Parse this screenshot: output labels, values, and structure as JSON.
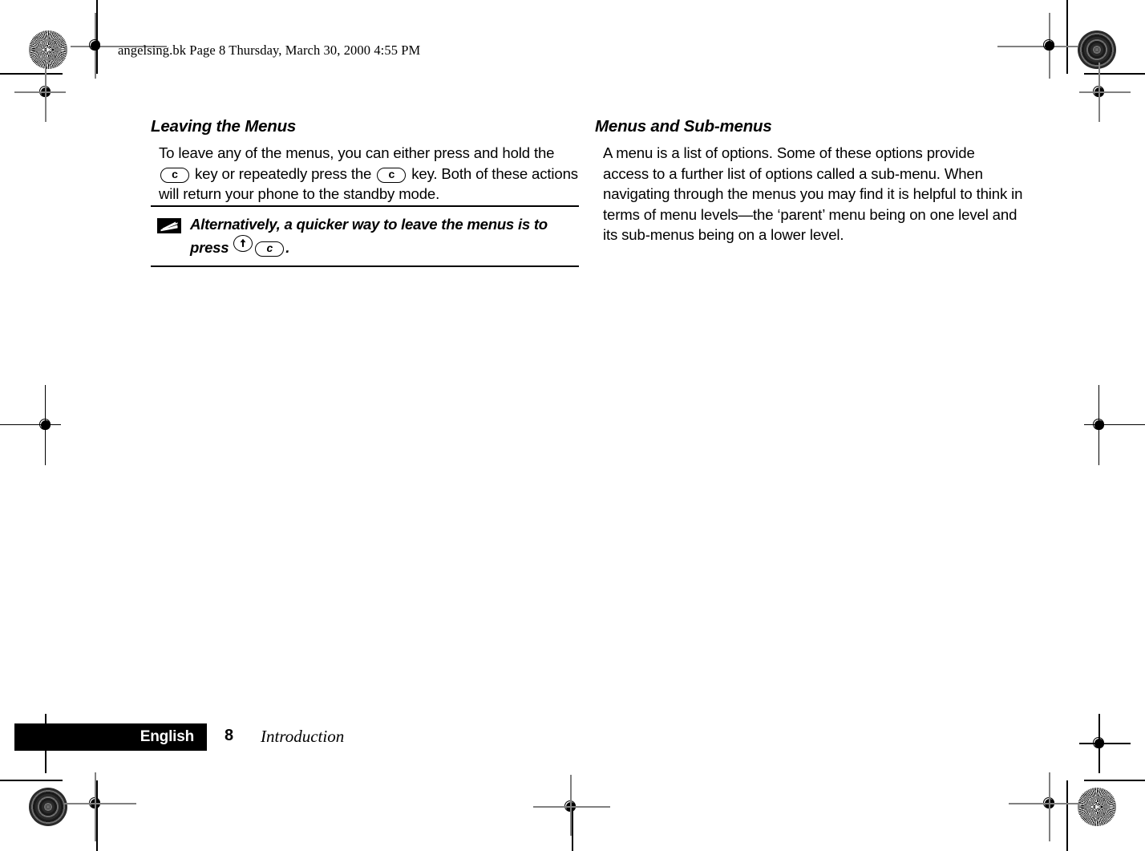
{
  "page": {
    "slug": "angelsing.bk  Page 8  Thursday, March 30, 2000  4:55 PM",
    "background": "#ffffff",
    "ink": "#000000"
  },
  "columns": {
    "left": {
      "heading": "Leaving the Menus",
      "paragraph_part1": "To leave any of the menus, you can either press and hold the ",
      "key1_label": "c",
      "paragraph_part2": " key or repeatedly press the ",
      "key2_label": "c",
      "paragraph_part3": " key. Both of these actions will return your phone to the standby mode."
    },
    "right": {
      "heading": "Menus and Sub-menus",
      "paragraph": "A menu is a list of options. Some of these options provide access to a further list of options called a sub-menu. When navigating through the menus you may find it is helpful to think in terms of menu levels—the ‘parent’ menu being on one level and its sub-menus being on a lower level."
    }
  },
  "note": {
    "icon_name": "lightning-bolt-icon",
    "text_part1": "Alternatively, a quicker way to leave the menus is to press ",
    "key_up_label": "",
    "key_c_label": "c",
    "text_part2": "."
  },
  "footer": {
    "language": "English",
    "page_number": "8",
    "chapter": "Introduction",
    "bar_color": "#000000",
    "text_color": "#ffffff"
  },
  "print_marks": {
    "rosette_topleft": "starburst-rosette",
    "rosette_topright": "concentric-ring-rosette",
    "rosette_bottomleft": "concentric-ring-rosette",
    "rosette_bottomright": "starburst-rosette",
    "registration_target": "registration-target"
  }
}
